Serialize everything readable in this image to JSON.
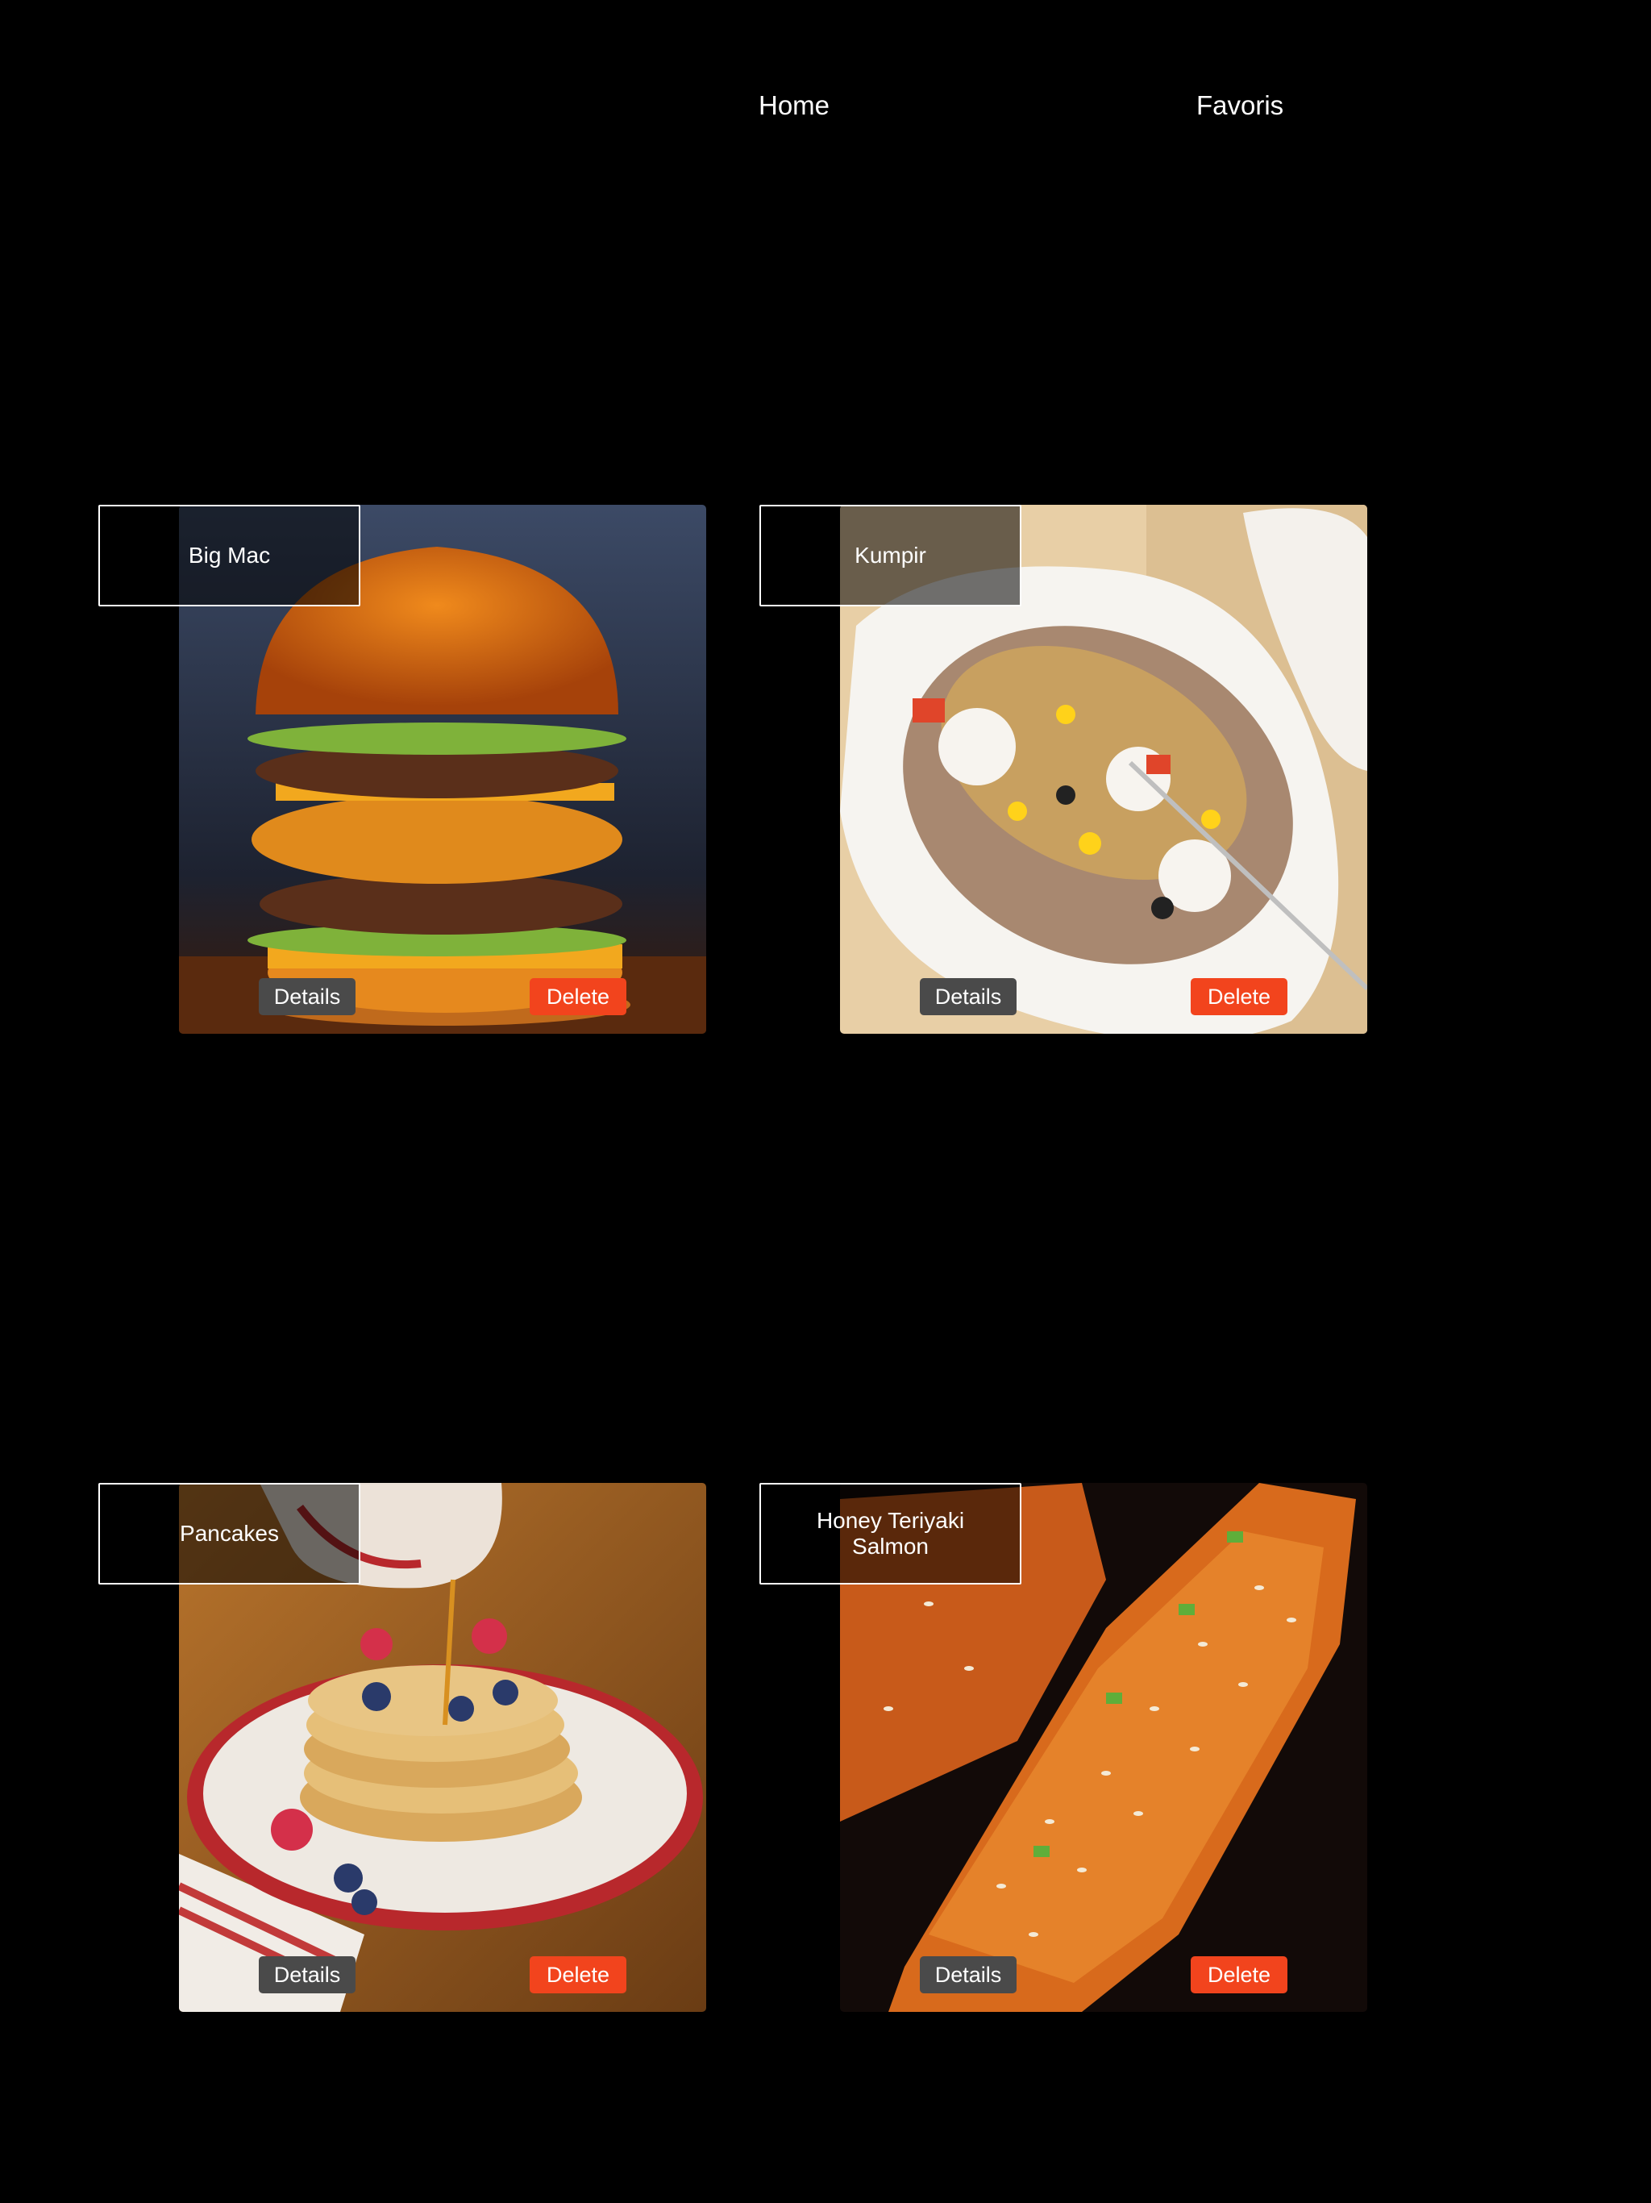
{
  "nav": {
    "home_label": "Home",
    "favorites_label": "Favoris"
  },
  "recipes": [
    {
      "title": "Big Mac",
      "details_label": "Details",
      "delete_label": "Delete"
    },
    {
      "title": "Kumpir",
      "details_label": "Details",
      "delete_label": "Delete"
    },
    {
      "title": "Pancakes",
      "details_label": "Details",
      "delete_label": "Delete"
    },
    {
      "title": "Honey Teriyaki Salmon",
      "details_label": "Details",
      "delete_label": "Delete"
    }
  ],
  "colors": {
    "background": "#000000",
    "details_button": "#4a4a4a",
    "delete_button": "#f2441d"
  }
}
